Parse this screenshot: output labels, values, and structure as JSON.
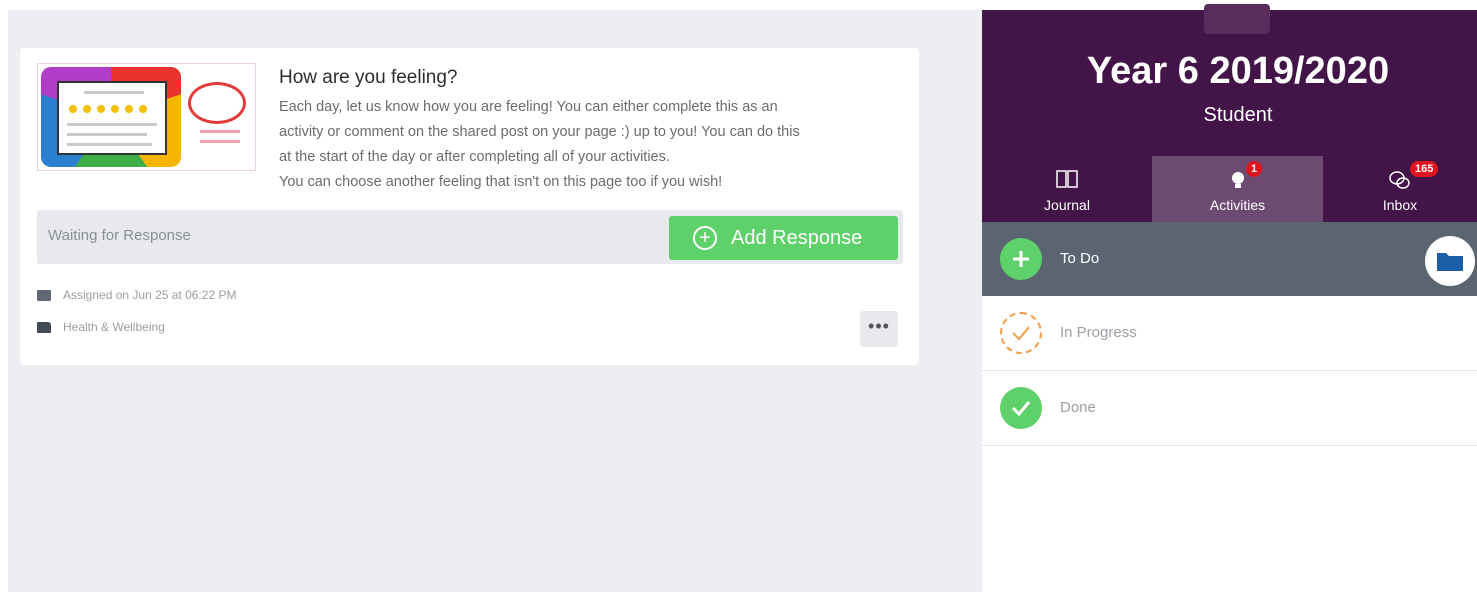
{
  "activity": {
    "title": "How are you feeling?",
    "description": [
      "Each day, let us know how you are feeling! You can either complete this as an",
      "activity or comment on the shared post on your page :) up to you! You can do this",
      "at the start of the day or after completing all of your activities.",
      "You can choose another feeling that isn't on this page too if you wish!"
    ],
    "response_status": "Waiting for Response",
    "add_response_label": "Add Response",
    "assigned": "Assigned on Jun 25 at 06:22 PM",
    "folder": "Health & Wellbeing",
    "more_label": "•••"
  },
  "sidebar": {
    "class_title": "Year 6 2019/2020",
    "role": "Student",
    "tabs": [
      {
        "label": "Journal",
        "icon": "book-icon",
        "badge": ""
      },
      {
        "label": "Activities",
        "icon": "lightbulb-icon",
        "badge": "1"
      },
      {
        "label": "Inbox",
        "icon": "chat-icon",
        "badge": "165"
      }
    ],
    "statuses": [
      {
        "label": "To Do",
        "icon": "plus-icon",
        "color": "#5ed16a"
      },
      {
        "label": "In Progress",
        "icon": "progress-check-icon",
        "color": "#f39c45"
      },
      {
        "label": "Done",
        "icon": "check-icon",
        "color": "#5ed16a"
      }
    ]
  },
  "colors": {
    "header_purple": "#431448",
    "active_tab": "#6d4a72",
    "todo_row": "#5b6572",
    "green": "#5ed16a",
    "badge_red": "#e0141e"
  }
}
